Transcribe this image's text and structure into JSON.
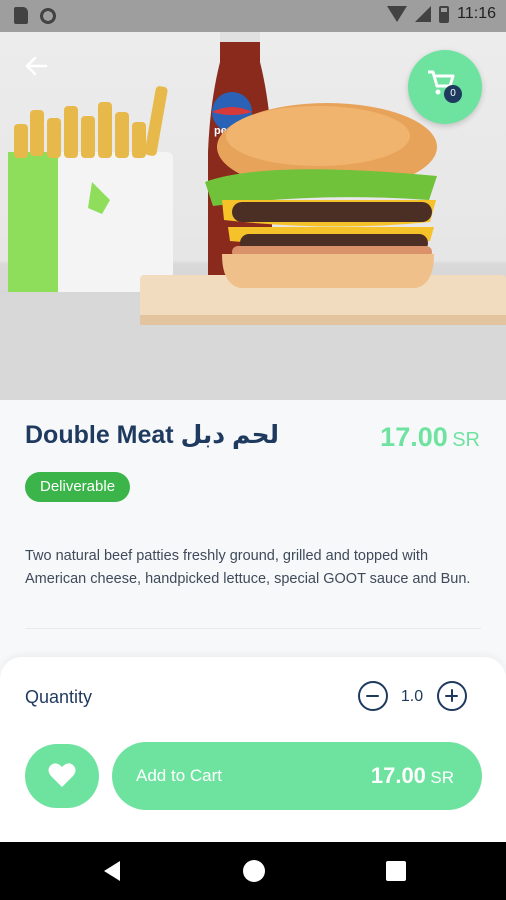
{
  "status_bar": {
    "time": "11:16",
    "icons": [
      "sd-card-icon",
      "circle-icon",
      "wifi-icon",
      "signal-icon",
      "battery-icon"
    ]
  },
  "header": {
    "back_icon": "arrow-left-icon",
    "cart_icon": "cart-icon",
    "cart_count": "0"
  },
  "hero": {
    "image": "burger-fries-pepsi-photo",
    "image_lettering": "pepsi"
  },
  "product": {
    "title": "Double Meat لحم دبل",
    "price_value": "17.00",
    "price_unit": "SR",
    "badge": "Deliverable",
    "description": "Two natural beef patties freshly ground, grilled and topped with American cheese, handpicked lettuce, special GOOT sauce and Bun."
  },
  "quantity": {
    "label": "Quantity",
    "value": "1.0"
  },
  "actions": {
    "favorite_icon": "heart-icon",
    "add_to_cart_label": "Add to Cart",
    "price_value": "17.00",
    "price_unit": "SR"
  },
  "colors": {
    "accent": "#6ee3a0",
    "badge_green": "#3bb54a",
    "navy": "#1f3a5f"
  }
}
